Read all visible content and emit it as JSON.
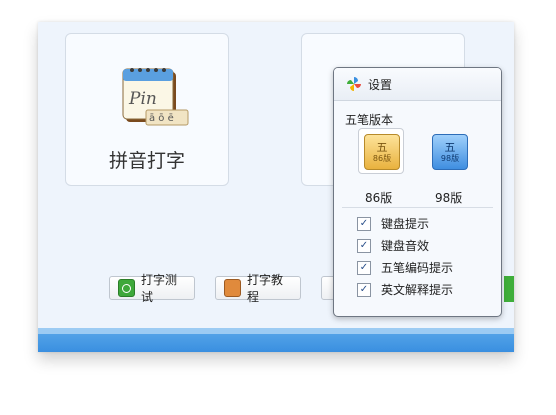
{
  "main": {
    "modes": [
      {
        "title": "拼音打字",
        "icon": "pin-book-icon",
        "icon_text": "Pin",
        "icon_sub": "ā ō ē"
      }
    ],
    "buttons": {
      "typing_test": "打字测试",
      "typing_tutorial": "打字教程"
    }
  },
  "settings": {
    "title": "设置",
    "section_label": "五笔版本",
    "versions": [
      {
        "label": "86版",
        "key_char": "五",
        "key_sub": "86版",
        "selected": true
      },
      {
        "label": "98版",
        "key_char": "五",
        "key_sub": "98版",
        "selected": false
      }
    ],
    "options": [
      {
        "label": "键盘提示",
        "checked": true
      },
      {
        "label": "键盘音效",
        "checked": true
      },
      {
        "label": "五笔编码提示",
        "checked": true
      },
      {
        "label": "英文解释提示",
        "checked": true
      }
    ]
  },
  "colors": {
    "accent_blue": "#3a8fe0",
    "accent_green": "#3fae3a",
    "key86": "#e9b23e",
    "key98": "#3f8ee0"
  }
}
